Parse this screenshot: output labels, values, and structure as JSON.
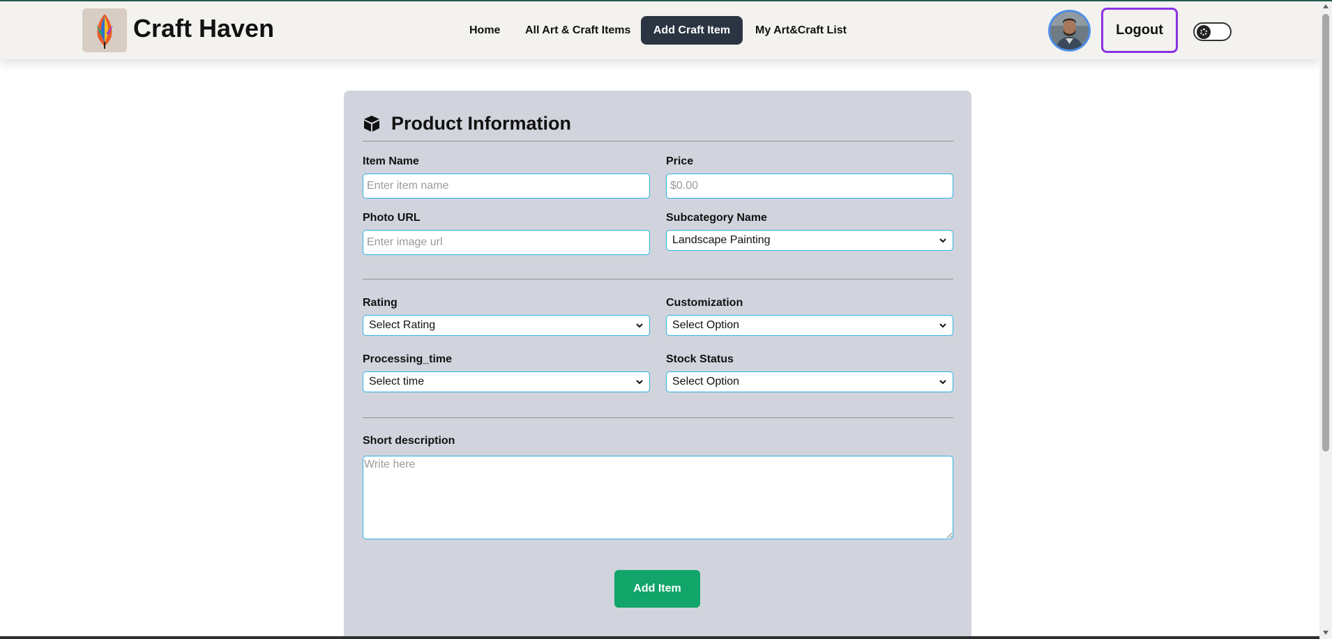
{
  "brand": {
    "name": "Craft Haven"
  },
  "nav": {
    "items": [
      {
        "label": "Home"
      },
      {
        "label": "All Art & Craft Items"
      },
      {
        "label": "Add Craft Item"
      },
      {
        "label": "My Art&Craft List"
      }
    ],
    "active_index": 2
  },
  "header": {
    "logout_label": "Logout"
  },
  "form": {
    "title": "Product Information",
    "item_name": {
      "label": "Item Name",
      "placeholder": "Enter item name"
    },
    "price": {
      "label": "Price",
      "placeholder": "$0.00"
    },
    "photo_url": {
      "label": "Photo URL",
      "placeholder": "Enter image url"
    },
    "subcategory": {
      "label": "Subcategory Name",
      "value": "Landscape Painting"
    },
    "rating": {
      "label": "Rating",
      "value": "Select Rating"
    },
    "customization": {
      "label": "Customization",
      "value": "Select Option"
    },
    "processing_time": {
      "label": "Processing_time",
      "value": "Select time"
    },
    "stock_status": {
      "label": "Stock Status",
      "value": "Select Option"
    },
    "short_description": {
      "label": "Short description",
      "placeholder": "Write here"
    },
    "submit_label": "Add Item"
  },
  "colors": {
    "active_nav_bg": "#2b3443",
    "logout_border": "#8b32e6",
    "field_border": "#2ab3e6",
    "submit_bg": "#11a56a",
    "card_bg": "#d1d4dc"
  },
  "icons": {
    "form_title": "cube-icon",
    "select_arrow": "chevron-down-icon",
    "theme_toggle": "toggle-icon"
  }
}
